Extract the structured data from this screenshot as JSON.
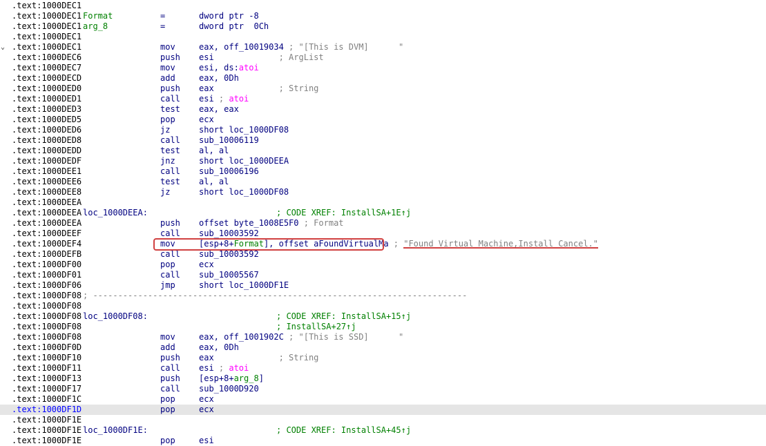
{
  "colors": {
    "background": "#ffffff",
    "default_text": "#000080",
    "address": "#000000",
    "current_address": "#0000ff",
    "current_line_bg": "#e5e5e5",
    "comment": "#808080",
    "xref": "#008000",
    "import_name": "#ff00ff",
    "stack_var": "#008000",
    "annotation": "#d04040"
  },
  "fold_icon": "chevron-down-icon",
  "lines": [
    {
      "addr": ".text:1000DEC1"
    },
    {
      "addr": ".text:1000DEC1",
      "label": [
        {
          "t": "Format",
          "c": "grn"
        }
      ],
      "mn": "=",
      "op": [
        {
          "t": "dword ptr -8"
        }
      ]
    },
    {
      "addr": ".text:1000DEC1",
      "label": [
        {
          "t": "arg_8",
          "c": "grn"
        }
      ],
      "mn": "=",
      "op": [
        {
          "t": "dword ptr  0Ch"
        }
      ]
    },
    {
      "addr": ".text:1000DEC1"
    },
    {
      "addr": ".text:1000DEC1",
      "fold": true,
      "mn": "mov",
      "op": [
        {
          "t": "eax, off_10019034 "
        },
        {
          "t": "; \"[This is DVM]      \"",
          "c": "cmt"
        }
      ]
    },
    {
      "addr": ".text:1000DEC6",
      "mn": "push",
      "op": [
        {
          "t": "esi             "
        },
        {
          "t": "; ArgList",
          "c": "cmt"
        }
      ]
    },
    {
      "addr": ".text:1000DEC7",
      "mn": "mov",
      "op": [
        {
          "t": "esi, ds:"
        },
        {
          "t": "atoi",
          "c": "mag"
        }
      ]
    },
    {
      "addr": ".text:1000DECD",
      "mn": "add",
      "op": [
        {
          "t": "eax, 0Dh"
        }
      ]
    },
    {
      "addr": ".text:1000DED0",
      "mn": "push",
      "op": [
        {
          "t": "eax             "
        },
        {
          "t": "; String",
          "c": "cmt"
        }
      ]
    },
    {
      "addr": ".text:1000DED1",
      "mn": "call",
      "op": [
        {
          "t": "esi "
        },
        {
          "t": "; ",
          "c": "cmt"
        },
        {
          "t": "atoi",
          "c": "mag"
        }
      ]
    },
    {
      "addr": ".text:1000DED3",
      "mn": "test",
      "op": [
        {
          "t": "eax, eax"
        }
      ]
    },
    {
      "addr": ".text:1000DED5",
      "mn": "pop",
      "op": [
        {
          "t": "ecx"
        }
      ]
    },
    {
      "addr": ".text:1000DED6",
      "mn": "jz",
      "op": [
        {
          "t": "short loc_1000DF08"
        }
      ]
    },
    {
      "addr": ".text:1000DED8",
      "mn": "call",
      "op": [
        {
          "t": "sub_10006119"
        }
      ]
    },
    {
      "addr": ".text:1000DEDD",
      "mn": "test",
      "op": [
        {
          "t": "al, al"
        }
      ]
    },
    {
      "addr": ".text:1000DEDF",
      "mn": "jnz",
      "op": [
        {
          "t": "short loc_1000DEEA"
        }
      ]
    },
    {
      "addr": ".text:1000DEE1",
      "mn": "call",
      "op": [
        {
          "t": "sub_10006196"
        }
      ]
    },
    {
      "addr": ".text:1000DEE6",
      "mn": "test",
      "op": [
        {
          "t": "al, al"
        }
      ]
    },
    {
      "addr": ".text:1000DEE8",
      "mn": "jz",
      "op": [
        {
          "t": "short loc_1000DF08"
        }
      ]
    },
    {
      "addr": ".text:1000DEEA"
    },
    {
      "addr": ".text:1000DEEA",
      "label": [
        {
          "t": "loc_1000DEEA:"
        }
      ],
      "xref": "; CODE XREF: InstallSA+1E↑j"
    },
    {
      "addr": ".text:1000DEEA",
      "mn": "push",
      "op": [
        {
          "t": "offset byte_1008E5F0 "
        },
        {
          "t": "; Format",
          "c": "cmt"
        }
      ]
    },
    {
      "addr": ".text:1000DEEF",
      "mn": "call",
      "op": [
        {
          "t": "sub_10003592"
        }
      ]
    },
    {
      "addr": ".text:1000DEF4",
      "mn": "mov",
      "op": [
        {
          "t": "[esp+8+"
        },
        {
          "t": "Format",
          "c": "grn"
        },
        {
          "t": "], offset aFoundVirtualMa "
        },
        {
          "t": "; ",
          "c": "cmt"
        },
        {
          "t": "\"Found Virtual Machine,Install Cancel.\"",
          "c": "cmt",
          "ul": true
        }
      ]
    },
    {
      "addr": ".text:1000DEFB",
      "mn": "call",
      "op": [
        {
          "t": "sub_10003592"
        }
      ]
    },
    {
      "addr": ".text:1000DF00",
      "mn": "pop",
      "op": [
        {
          "t": "ecx"
        }
      ]
    },
    {
      "addr": ".text:1000DF01",
      "mn": "call",
      "op": [
        {
          "t": "sub_10005567"
        }
      ]
    },
    {
      "addr": ".text:1000DF06",
      "mn": "jmp",
      "op": [
        {
          "t": "short loc_1000DF1E"
        }
      ]
    },
    {
      "addr": ".text:1000DF08",
      "sep": "; ---------------------------------------------------------------------------"
    },
    {
      "addr": ".text:1000DF08"
    },
    {
      "addr": ".text:1000DF08",
      "label": [
        {
          "t": "loc_1000DF08:"
        }
      ],
      "xref": "; CODE XREF: InstallSA+15↑j"
    },
    {
      "addr": ".text:1000DF08",
      "xref": "; InstallSA+27↑j"
    },
    {
      "addr": ".text:1000DF08",
      "mn": "mov",
      "op": [
        {
          "t": "eax, off_1001902C "
        },
        {
          "t": "; \"[This is SSD]      \"",
          "c": "cmt"
        }
      ]
    },
    {
      "addr": ".text:1000DF0D",
      "mn": "add",
      "op": [
        {
          "t": "eax, 0Dh"
        }
      ]
    },
    {
      "addr": ".text:1000DF10",
      "mn": "push",
      "op": [
        {
          "t": "eax             "
        },
        {
          "t": "; String",
          "c": "cmt"
        }
      ]
    },
    {
      "addr": ".text:1000DF11",
      "mn": "call",
      "op": [
        {
          "t": "esi "
        },
        {
          "t": "; ",
          "c": "cmt"
        },
        {
          "t": "atoi",
          "c": "mag"
        }
      ]
    },
    {
      "addr": ".text:1000DF13",
      "mn": "push",
      "op": [
        {
          "t": "[esp+8+"
        },
        {
          "t": "arg_8",
          "c": "grn"
        },
        {
          "t": "]"
        }
      ]
    },
    {
      "addr": ".text:1000DF17",
      "mn": "call",
      "op": [
        {
          "t": "sub_1000D920"
        }
      ]
    },
    {
      "addr": ".text:1000DF1C",
      "mn": "pop",
      "op": [
        {
          "t": "ecx"
        }
      ]
    },
    {
      "addr": ".text:1000DF1D",
      "current": true,
      "mn": "pop",
      "op": [
        {
          "t": "ecx"
        }
      ]
    },
    {
      "addr": ".text:1000DF1E"
    },
    {
      "addr": ".text:1000DF1E",
      "label": [
        {
          "t": "loc_1000DF1E:"
        }
      ],
      "xref": "; CODE XREF: InstallSA+45↑j"
    },
    {
      "addr": ".text:1000DF1E",
      "mn": "pop",
      "op": [
        {
          "t": "esi"
        }
      ]
    }
  ]
}
